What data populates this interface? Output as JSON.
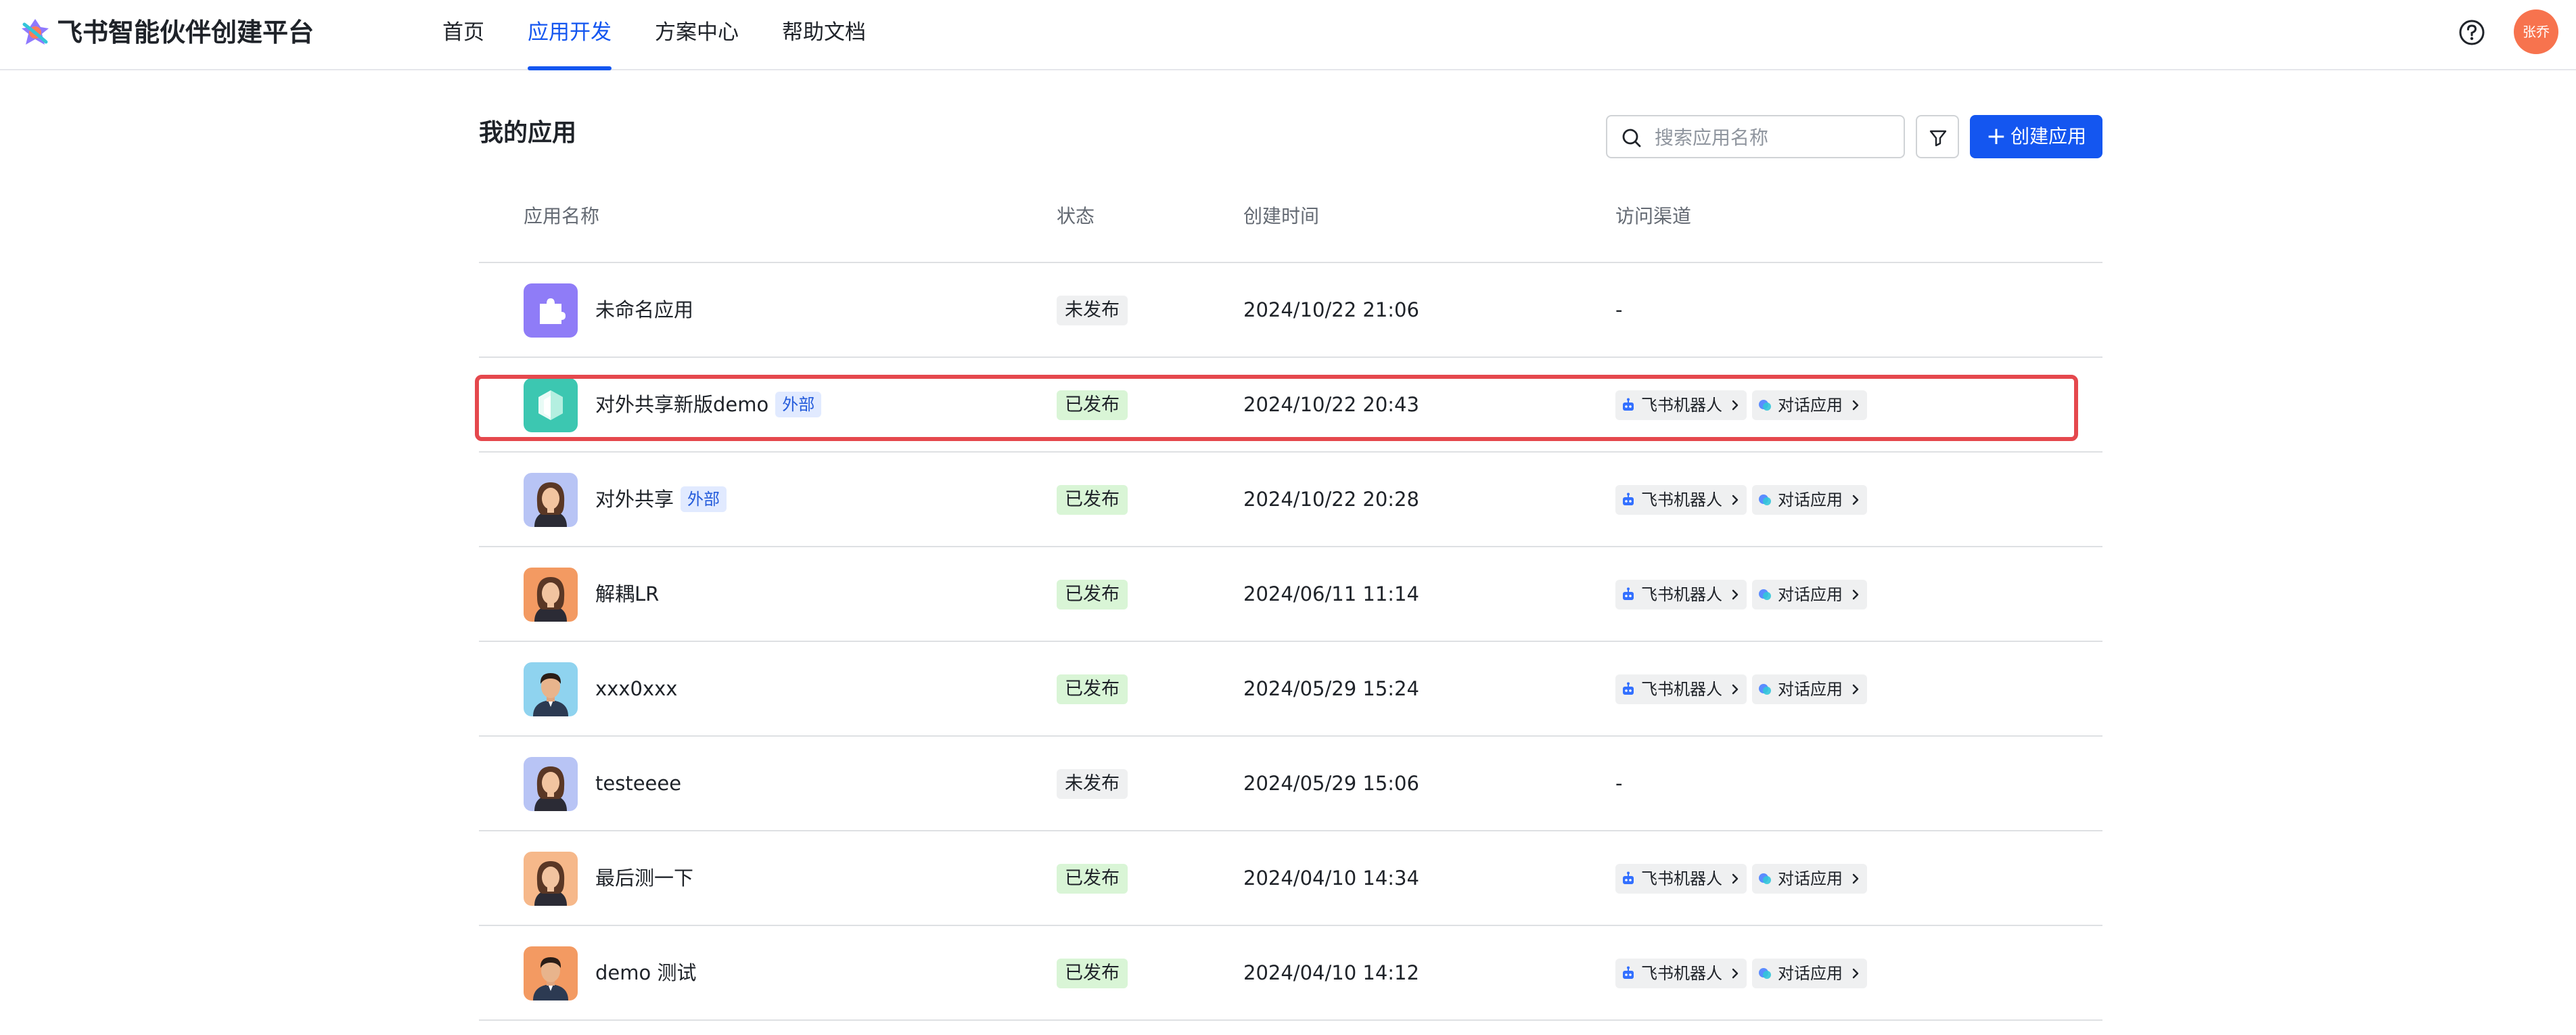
{
  "header": {
    "brand": "飞书智能伙伴创建平台",
    "nav": [
      {
        "label": "首页",
        "active": false
      },
      {
        "label": "应用开发",
        "active": true
      },
      {
        "label": "方案中心",
        "active": false
      },
      {
        "label": "帮助文档",
        "active": false
      }
    ],
    "user_avatar_text": "张乔"
  },
  "toolbar": {
    "title": "我的应用",
    "search_placeholder": "搜索应用名称",
    "create_label": "创建应用"
  },
  "table": {
    "columns": [
      "应用名称",
      "状态",
      "创建时间",
      "访问渠道"
    ],
    "channel_labels": {
      "bot": "飞书机器人",
      "chat": "对话应用"
    },
    "rows": [
      {
        "name": "未命名应用",
        "tag": "",
        "status": "未发布",
        "published": false,
        "created": "2024/10/22 21:06",
        "channels": "-",
        "icon": "puzzle-icon",
        "icon_color": "#8f7cf7"
      },
      {
        "name": "对外共享新版demo",
        "tag": "外部",
        "status": "已发布",
        "published": true,
        "created": "2024/10/22 20:43",
        "channels": "",
        "icon": "cube-icon",
        "icon_color": "#3cc7b1"
      },
      {
        "name": "对外共享",
        "tag": "外部",
        "status": "已发布",
        "published": true,
        "created": "2024/10/22 20:28",
        "channels": "",
        "icon": "woman-avatar-icon",
        "icon_color": "#b8c4f5"
      },
      {
        "name": "解耦LR",
        "tag": "",
        "status": "已发布",
        "published": true,
        "created": "2024/06/11 11:14",
        "channels": "",
        "icon": "woman-avatar-icon",
        "icon_color": "#f39a62"
      },
      {
        "name": "xxx0xxx",
        "tag": "",
        "status": "已发布",
        "published": true,
        "created": "2024/05/29 15:24",
        "channels": "",
        "icon": "man-avatar-icon",
        "icon_color": "#8fd3ef"
      },
      {
        "name": "testeeee",
        "tag": "",
        "status": "未发布",
        "published": false,
        "created": "2024/05/29 15:06",
        "channels": "-",
        "icon": "woman-avatar-icon",
        "icon_color": "#b8c4f5"
      },
      {
        "name": "最后测一下",
        "tag": "",
        "status": "已发布",
        "published": true,
        "created": "2024/04/10 14:34",
        "channels": "",
        "icon": "woman-avatar-icon",
        "icon_color": "#f6b88a"
      },
      {
        "name": "demo 测试",
        "tag": "",
        "status": "已发布",
        "published": true,
        "created": "2024/04/10 14:12",
        "channels": "",
        "icon": "man-avatar-icon",
        "icon_color": "#f39a62"
      }
    ]
  }
}
